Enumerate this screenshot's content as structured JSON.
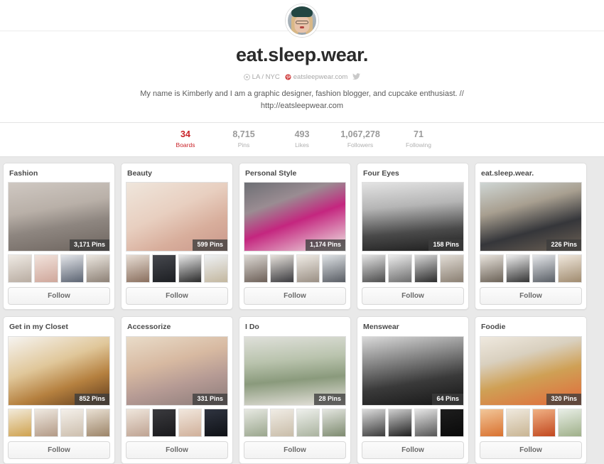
{
  "profile": {
    "name": "eat.sleep.wear.",
    "avatar_icon": "user-avatar-photo",
    "location": "LA / NYC",
    "location_icon": "location-pin-icon",
    "website": "eatsleepwear.com",
    "website_icon": "verified-badge-icon",
    "twitter_icon": "twitter-bird-icon",
    "bio": "My name is Kimberly and I am a graphic designer, fashion blogger, and cupcake enthusiast. // http://eatsleepwear.com"
  },
  "stats": [
    {
      "value": "34",
      "label": "Boards",
      "active": true
    },
    {
      "value": "8,715",
      "label": "Pins",
      "active": false
    },
    {
      "value": "493",
      "label": "Likes",
      "active": false
    },
    {
      "value": "1,067,278",
      "label": "Followers",
      "active": false
    },
    {
      "value": "71",
      "label": "Following",
      "active": false
    }
  ],
  "follow_label": "Follow",
  "colors": {
    "accent_red": "#c92228",
    "page_bg": "#e9e9e9",
    "card_bg": "#ffffff",
    "text_dark": "#2b2b2b",
    "text_muted": "#a8a8a8"
  },
  "boards": [
    {
      "title": "Fashion",
      "pins": "3,171 Pins"
    },
    {
      "title": "Beauty",
      "pins": "599 Pins"
    },
    {
      "title": "Personal Style",
      "pins": "1,174 Pins"
    },
    {
      "title": "Four Eyes",
      "pins": "158 Pins"
    },
    {
      "title": "eat.sleep.wear.",
      "pins": "226 Pins"
    },
    {
      "title": "Get in my Closet",
      "pins": "852 Pins"
    },
    {
      "title": "Accessorize",
      "pins": "331 Pins"
    },
    {
      "title": "I Do",
      "pins": "28 Pins"
    },
    {
      "title": "Menswear",
      "pins": "64 Pins"
    },
    {
      "title": "Foodie",
      "pins": "320 Pins"
    }
  ]
}
